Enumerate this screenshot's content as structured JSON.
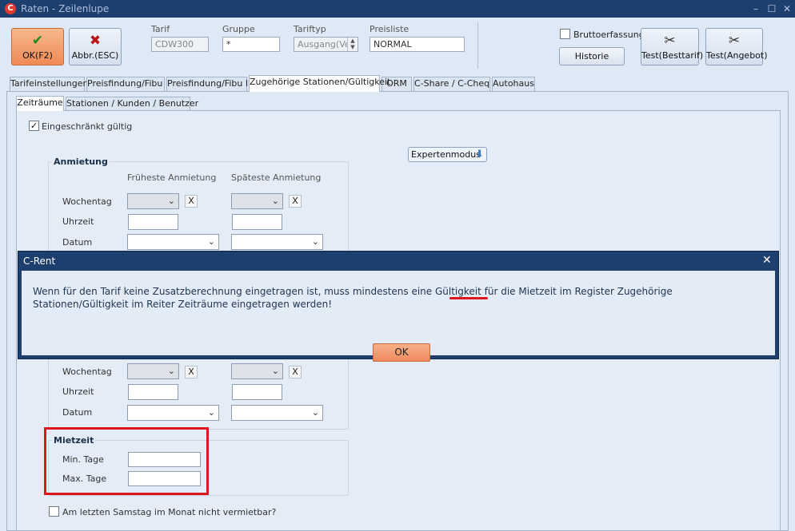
{
  "window": {
    "app_logo": "C",
    "title": "Raten - Zeilenlupe",
    "controls": [
      "–",
      "☐",
      "✕"
    ]
  },
  "toolbar": {
    "ok_label": "OK(F2)",
    "ok_icon": "check-icon",
    "abbr_label": "Abbr.(ESC)",
    "abbr_icon": "x-icon",
    "tarif_label": "Tarif",
    "tarif_value": "CDW300",
    "gruppe_label": "Gruppe",
    "gruppe_value": "*",
    "tariftyp_label": "Tariftyp",
    "tariftyp_value": "Ausgang(Ver",
    "preisliste_label": "Preisliste",
    "preisliste_value": "NORMAL",
    "bruttoerfassung_label": "Bruttoerfassung",
    "historie_label": "Historie",
    "test_besttarif_label": "Test(Besttarif)",
    "test_angebot_label": "Test(Angebot)"
  },
  "tabs": [
    {
      "label": "Tarifeinstellungen"
    },
    {
      "label": "Preisfindung/Fibu I"
    },
    {
      "label": "Preisfindung/Fibu II"
    },
    {
      "label": "Zugehörige Stationen/Gültigkeit"
    },
    {
      "label": "ORM"
    },
    {
      "label": "C-Share / C-Cheq"
    },
    {
      "label": "Autohaus"
    }
  ],
  "subtabs": [
    {
      "label": "Zeiträume"
    },
    {
      "label": "Stationen / Kunden / Benutzer"
    }
  ],
  "panel": {
    "eingeschraenkt_label": "Eingeschränkt gültig",
    "eingeschraenkt_checked": "✓",
    "expertenmodus_label": "Expertenmodus",
    "anmietung": {
      "title": "Anmietung",
      "col_frueheste": "Früheste Anmietung",
      "col_spaeteste": "Späteste Anmietung",
      "wochentag": "Wochentag",
      "uhrzeit": "Uhrzeit",
      "datum": "Datum"
    },
    "rueckgabe": {
      "wochentag": "Wochentag",
      "uhrzeit": "Uhrzeit",
      "datum": "Datum"
    },
    "mietzeit": {
      "title": "Mietzeit",
      "min_tage": "Min. Tage",
      "max_tage": "Max. Tage"
    },
    "samstag_label": "Am letzten Samstag im Monat nicht vermietbar?",
    "clear_glyph": "X",
    "dropdown_glyph": "⌄"
  },
  "dialog": {
    "title": "C-Rent",
    "close": "✕",
    "message": "Wenn für den Tarif keine Zusatzberechnung eingetragen ist, muss mindestens eine Gültigkeit für die Mietzeit im Register Zugehörige Stationen/Gültigkeit im Reiter Zeiträume eingetragen werden!",
    "ok_label": "OK"
  },
  "colors": {
    "title_bar": "#1d3f6e",
    "ok_button": "#ef8a56",
    "highlight": "#e0141d",
    "panel_bg": "#e3ecf7"
  }
}
